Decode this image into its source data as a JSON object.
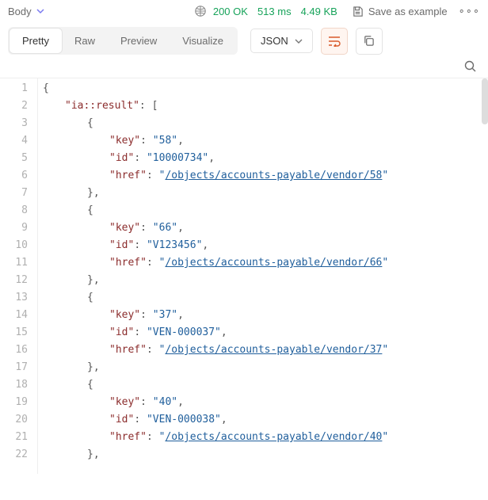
{
  "header": {
    "body_label": "Body",
    "status_code": "200 OK",
    "time": "513 ms",
    "size": "4.49 KB",
    "save_example": "Save as example"
  },
  "tabs": {
    "pretty": "Pretty",
    "raw": "Raw",
    "preview": "Preview",
    "visualize": "Visualize"
  },
  "format_dropdown": "JSON",
  "response": {
    "root_key": "ia::result",
    "items": [
      {
        "key": "58",
        "id": "10000734",
        "href": "/objects/accounts-payable/vendor/58"
      },
      {
        "key": "66",
        "id": "V123456",
        "href": "/objects/accounts-payable/vendor/66"
      },
      {
        "key": "37",
        "id": "VEN-000037",
        "href": "/objects/accounts-payable/vendor/37"
      },
      {
        "key": "40",
        "id": "VEN-000038",
        "href": "/objects/accounts-payable/vendor/40"
      }
    ]
  }
}
